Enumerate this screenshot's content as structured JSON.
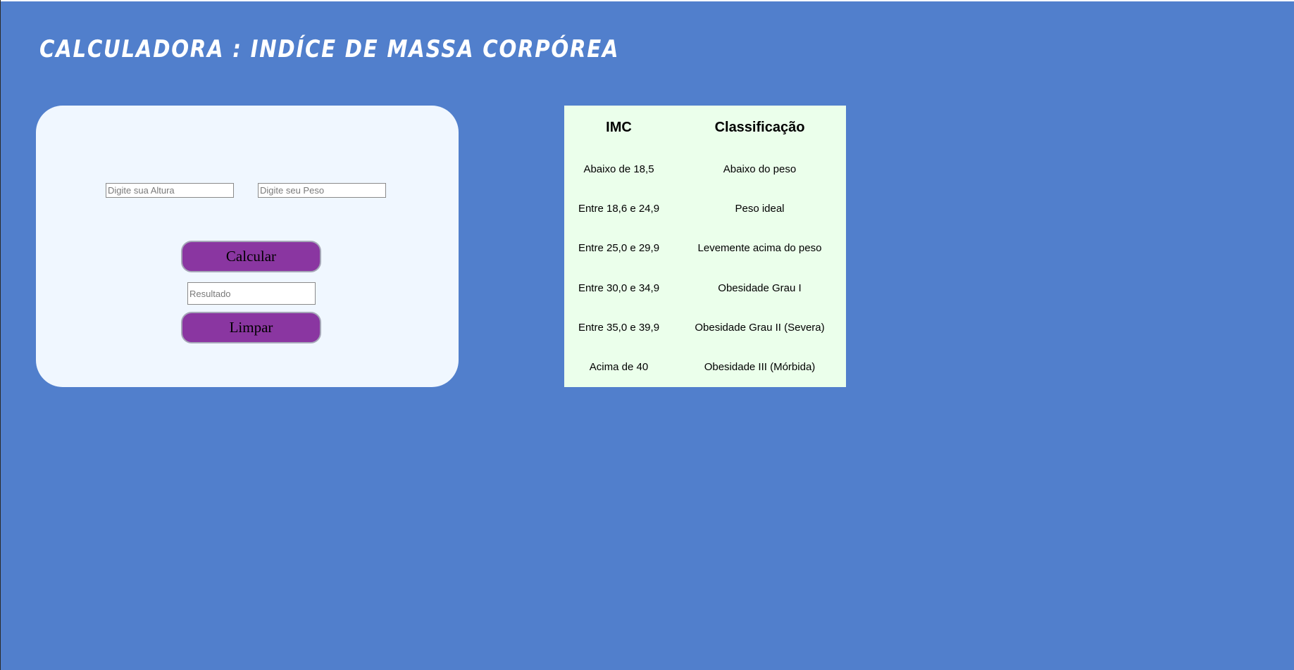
{
  "header": {
    "title": "Calculadora : Indíce de massa corpórea"
  },
  "form": {
    "altura_placeholder": "Digite sua Altura",
    "altura_value": "",
    "peso_placeholder": "Digite seu Peso",
    "peso_value": "",
    "calcular_label": "Calcular",
    "resultado_placeholder": "Resultado",
    "resultado_value": "",
    "limpar_label": "Limpar"
  },
  "table": {
    "headers": [
      "IMC",
      "Classificação"
    ],
    "rows": [
      [
        "Abaixo de 18,5",
        "Abaixo do peso"
      ],
      [
        "Entre 18,6 e 24,9",
        "Peso ideal"
      ],
      [
        "Entre 25,0 e 29,9",
        "Levemente acima do peso"
      ],
      [
        "Entre 30,0 e 34,9",
        "Obesidade Grau I"
      ],
      [
        "Entre 35,0 e 39,9",
        "Obesidade Grau II (Severa)"
      ],
      [
        "Acima de 40",
        "Obesidade III (Mórbida)"
      ]
    ]
  },
  "colors": {
    "page_background": "#517fcc",
    "card_background": "#f0f7ff",
    "table_background": "#ebffeb",
    "button_background": "#8a36a1",
    "title_color": "#ffffff"
  }
}
